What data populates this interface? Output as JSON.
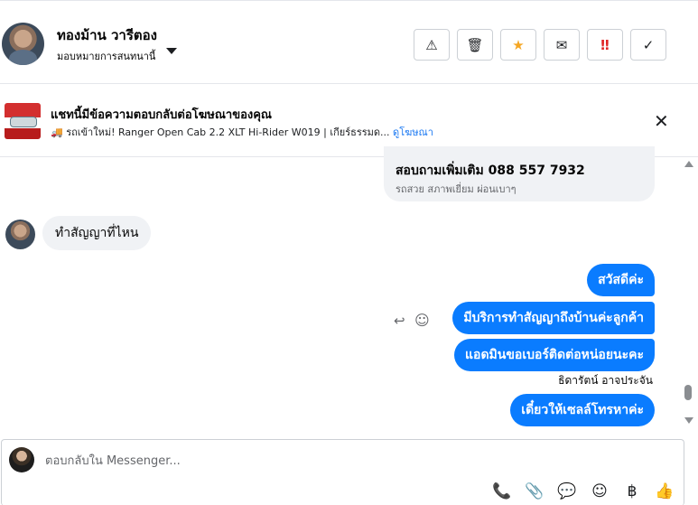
{
  "header": {
    "contact_name": "ทองม้าน วารีตอง",
    "assign_label": "มอบหมายการสนทนานี้",
    "actions": [
      {
        "name": "spam",
        "glyph": "⚠"
      },
      {
        "name": "delete",
        "glyph": "🗑"
      },
      {
        "name": "star",
        "glyph": "★"
      },
      {
        "name": "email",
        "glyph": "✉"
      },
      {
        "name": "urgent",
        "glyph": "‼"
      },
      {
        "name": "done",
        "glyph": "✓"
      }
    ]
  },
  "ad_banner": {
    "title": "แชทนี้มีข้อความตอบกลับต่อโฆษณาของคุณ",
    "description": "🚚 รถเข้าใหม่! Ranger Open Cab 2.2 XLT Hi-Rider W019 | เกียร์ธรรมด...",
    "link": "ดูโฆษณา",
    "close_glyph": "✕"
  },
  "messages": {
    "ad_card_title": "สอบถามเพิ่มเติม 088 557 7932",
    "ad_card_subtitle": "รถสวย สภาพเยี่ยม ผ่อนเบาๆ",
    "incoming": "ทำสัญญาที่ไหน",
    "outgoing": [
      "สวัสดีค่ะ",
      "มีบริการทำสัญญาถึงบ้านค่ะลูกค้า",
      "แอดมินขอเบอร์ติดต่อหน่อยนะคะ",
      "เดี๋ยวให้เซลล์โทรหาค่ะ"
    ],
    "sender_name": "ธิดารัตน์ อาจประจัน",
    "reply_glyph": "↩",
    "react_glyph": "☺"
  },
  "composer": {
    "placeholder": "ตอบกลับใน Messenger...",
    "tools": [
      {
        "name": "call-add",
        "glyph": "📞"
      },
      {
        "name": "attach",
        "glyph": "📎"
      },
      {
        "name": "saved-reply",
        "glyph": "💬"
      },
      {
        "name": "emoji",
        "glyph": "☺"
      },
      {
        "name": "payment",
        "glyph": "฿"
      },
      {
        "name": "like",
        "glyph": "👍"
      }
    ]
  },
  "colors": {
    "accent": "#0a7cff",
    "link": "#1877f2",
    "star": "#f5a623",
    "urgent": "#e02424"
  }
}
